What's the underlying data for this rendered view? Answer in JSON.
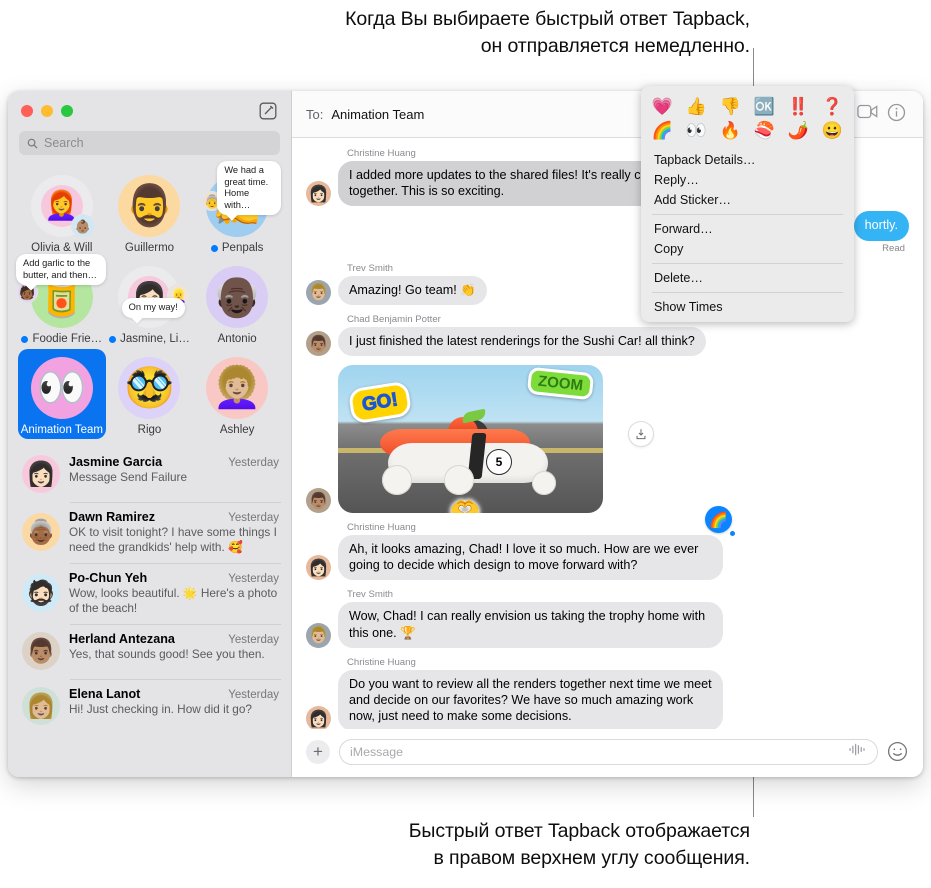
{
  "annotations": {
    "top": "Когда Вы выбираете быстрый ответ Tapback,\nон отправляется немедленно.",
    "top_line1": "Когда Вы выбираете быстрый ответ Tapback,",
    "top_line2": "он отправляется немедленно.",
    "bottom_line1": "Быстрый ответ Tapback отображается",
    "bottom_line2": "в правом верхнем углу сообщения."
  },
  "sidebar": {
    "window_controls": {
      "close": "close-button",
      "minimize": "minimize-button",
      "zoom": "zoom-button"
    },
    "compose_label": "compose-icon",
    "search": {
      "placeholder": "Search",
      "icon": "search-icon"
    },
    "pinned": [
      {
        "label": "Olivia & Will",
        "unread": false,
        "avatar_emoji": "👩‍🦰",
        "avatar_bg": "#f7c7dd",
        "ring_bg": "#ebebed",
        "badge_emoji": "👶🏽",
        "badge_bg": "#cfe8f7"
      },
      {
        "label": "Guillermo",
        "unread": false,
        "avatar_emoji": "🧔‍♂️",
        "avatar_bg": "#fcd9a1"
      },
      {
        "label": "Penpals",
        "unread": true,
        "avatar_emoji": "✍️",
        "avatar_bg": "#9ecdf0",
        "tip": "We had a great time. Home with…",
        "badge_emoji": "👵",
        "badge_bg": "#f0e0d0"
      },
      {
        "label": "Foodie Frie…",
        "unread": true,
        "avatar_emoji": "🥫",
        "avatar_bg": "#b5e6a0",
        "tip": "Add garlic to the butter, and then…",
        "badge_emoji": "🧑🏾",
        "badge_bg": "#e3d2f2"
      },
      {
        "label": "Jasmine, Li…",
        "unread": true,
        "avatar_emoji": "👩🏻",
        "avatar_bg": "#f7c9dd",
        "ring_bg": "#ebebed",
        "tip": "On my way!",
        "badge_emoji": "👱‍♀️",
        "badge_bg": "#efe4d8"
      },
      {
        "label": "Antonio",
        "unread": false,
        "avatar_emoji": "👴🏿",
        "avatar_bg": "#d9cdf5"
      },
      {
        "label": "Animation Team",
        "unread": false,
        "selected": true,
        "avatar_emoji": "👀",
        "avatar_bg": "#f2a2e0"
      },
      {
        "label": "Rigo",
        "unread": false,
        "avatar_emoji": "🥸",
        "avatar_bg": "#ddd2f8"
      },
      {
        "label": "Ashley",
        "unread": false,
        "avatar_emoji": "👩🏼‍🦱",
        "avatar_bg": "#fac8c4"
      }
    ],
    "conversations": [
      {
        "name": "Jasmine Garcia",
        "time": "Yesterday",
        "preview": "Message Send Failure",
        "avatar_emoji": "👩🏻",
        "avatar_bg": "#f8c8dc"
      },
      {
        "name": "Dawn Ramirez",
        "time": "Yesterday",
        "preview": "OK to visit tonight? I have some things I need the grandkids' help with. 🥰",
        "avatar_emoji": "👵🏾",
        "avatar_bg": "#fbd9a5"
      },
      {
        "name": "Po-Chun Yeh",
        "time": "Yesterday",
        "preview": "Wow, looks beautiful. 🌟 Here's a photo of the beach!",
        "avatar_emoji": "🧔🏻",
        "avatar_bg": "#cfeaf7"
      },
      {
        "name": "Herland Antezana",
        "time": "Yesterday",
        "preview": "Yes, that sounds good! See you then.",
        "avatar_emoji": "👨🏽",
        "avatar_bg": "#dcd2c6"
      },
      {
        "name": "Elena Lanot",
        "time": "Yesterday",
        "preview": "Hi! Just checking in. How did it go?",
        "avatar_emoji": "👩🏼",
        "avatar_bg": "#cfe0d8"
      }
    ]
  },
  "thread": {
    "to_label": "To:",
    "recipient": "Animation Team",
    "facetime_icon": "facetime-video-icon",
    "info_icon": "info-icon",
    "messages": [
      {
        "sender": "Christine Huang",
        "text": "I added more updates to the shared files! It's really coming together. This is so exciting.",
        "dim": true,
        "avatar_emoji": "👩🏻",
        "avatar_bg": "#e8b89a"
      },
      {
        "sender": "",
        "text": "hortly.",
        "outgoing": true,
        "status": "Read"
      },
      {
        "sender": "Trev Smith",
        "text": "Amazing! Go team! 👏",
        "avatar_emoji": "👨🏼",
        "avatar_bg": "#9aa5ae"
      },
      {
        "sender": "Chad Benjamin Potter",
        "text": "I just finished the latest renderings for the Sushi Car! all think?",
        "avatar_emoji": "👨🏽",
        "avatar_bg": "#b2a08a"
      },
      {
        "sender": "",
        "image": true,
        "avatar_emoji": "👨🏽",
        "avatar_bg": "#b2a08a",
        "sticker_go": "GO!",
        "sticker_zoom": "ZOOM",
        "sticker_hands": "🫶",
        "car_number": "5",
        "save_icon": "save-image-icon"
      },
      {
        "sender": "Christine Huang",
        "text": "Ah, it looks amazing, Chad! I love it so much. How are we ever going to decide which design to move forward with?",
        "avatar_emoji": "👩🏻",
        "avatar_bg": "#e8b89a",
        "tapback": "🌈"
      },
      {
        "sender": "Trev Smith",
        "text": "Wow, Chad! I can really envision us taking the trophy home with this one. 🏆",
        "avatar_emoji": "👨🏼",
        "avatar_bg": "#9aa5ae"
      },
      {
        "sender": "Christine Huang",
        "text": "Do you want to review all the renders together next time we meet and decide on our favorites? We have so much amazing work now, just need to make some decisions.",
        "avatar_emoji": "👩🏻",
        "avatar_bg": "#e8b89a"
      }
    ],
    "composer": {
      "plus_label": "+",
      "placeholder": "iMessage",
      "audio_icon": "audio-waveform-icon",
      "emoji_icon": "emoji-picker-icon"
    }
  },
  "context_menu": {
    "tapbacks_row1": [
      "💗",
      "👍",
      "👎",
      "🆗",
      "‼️",
      "❓"
    ],
    "tapbacks_row2": [
      "🌈",
      "👀",
      "🔥",
      "🍣",
      "🌶️",
      "😀"
    ],
    "items": [
      {
        "label": "Tapback Details…",
        "sep_after": false
      },
      {
        "label": "Reply…",
        "sep_after": false
      },
      {
        "label": "Add Sticker…",
        "sep_after": true
      },
      {
        "label": "Forward…",
        "sep_after": false
      },
      {
        "label": "Copy",
        "sep_after": true
      },
      {
        "label": "Delete…",
        "sep_after": true
      },
      {
        "label": "Show Times",
        "sep_after": false
      }
    ]
  },
  "colors": {
    "accent_blue": "#0a74f0",
    "bubble_gray": "#e6e6e8",
    "bubble_blue": "#35b4f5",
    "unread_dot": "#007aff"
  }
}
